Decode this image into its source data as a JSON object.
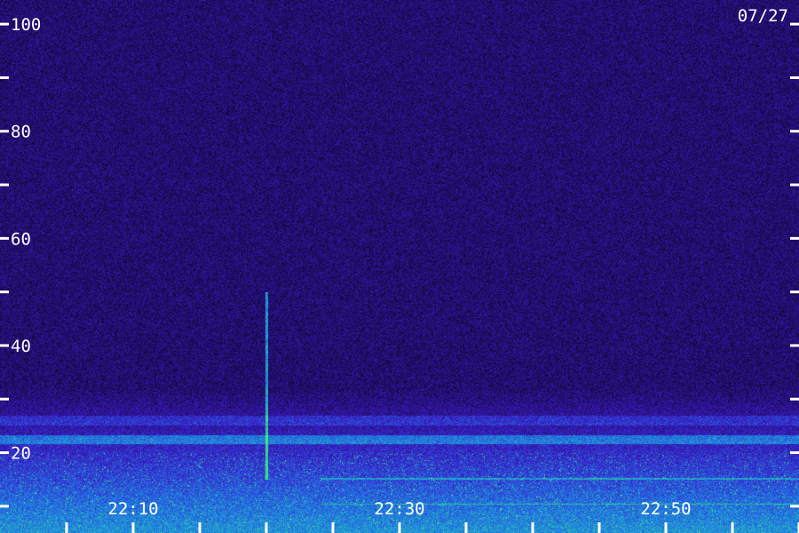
{
  "chart_data": {
    "type": "heatmap",
    "title": "",
    "date_label": "07/27",
    "xlabel": "",
    "ylabel": "",
    "y_ticks": [
      {
        "value": 100,
        "label": "100"
      },
      {
        "value": 90,
        "label": ""
      },
      {
        "value": 80,
        "label": "80"
      },
      {
        "value": 70,
        "label": ""
      },
      {
        "value": 60,
        "label": "60"
      },
      {
        "value": 50,
        "label": ""
      },
      {
        "value": 40,
        "label": "40"
      },
      {
        "value": 30,
        "label": ""
      },
      {
        "value": 20,
        "label": "20"
      },
      {
        "value": 10,
        "label": ""
      }
    ],
    "ylim": [
      5,
      104.5
    ],
    "x_ticks": [
      {
        "value": "22:05",
        "label": ""
      },
      {
        "value": "22:10",
        "label": "22:10"
      },
      {
        "value": "22:15",
        "label": ""
      },
      {
        "value": "22:20",
        "label": ""
      },
      {
        "value": "22:25",
        "label": ""
      },
      {
        "value": "22:30",
        "label": "22:30"
      },
      {
        "value": "22:35",
        "label": ""
      },
      {
        "value": "22:40",
        "label": ""
      },
      {
        "value": "22:45",
        "label": ""
      },
      {
        "value": "22:50",
        "label": "22:50"
      },
      {
        "value": "22:55",
        "label": ""
      },
      {
        "value": "23:00",
        "label": ""
      }
    ],
    "xlim": [
      "22:00",
      "23:00"
    ],
    "colors": {
      "background": "#1a0a44",
      "noise": "#3a1cc8",
      "mid": "#1e6fe0",
      "high": "#2fe07a",
      "labels": "#ffffff"
    },
    "features": [
      {
        "kind": "vertical-streak",
        "time": "22:20",
        "y_from": 15,
        "y_to": 50
      },
      {
        "kind": "horizontal-band",
        "y": 22.5,
        "intensity": "medium"
      },
      {
        "kind": "horizontal-band",
        "y": 26,
        "intensity": "low"
      },
      {
        "kind": "broadband-activity",
        "y_from": 5,
        "y_to": 20,
        "intensity": "high"
      }
    ]
  }
}
